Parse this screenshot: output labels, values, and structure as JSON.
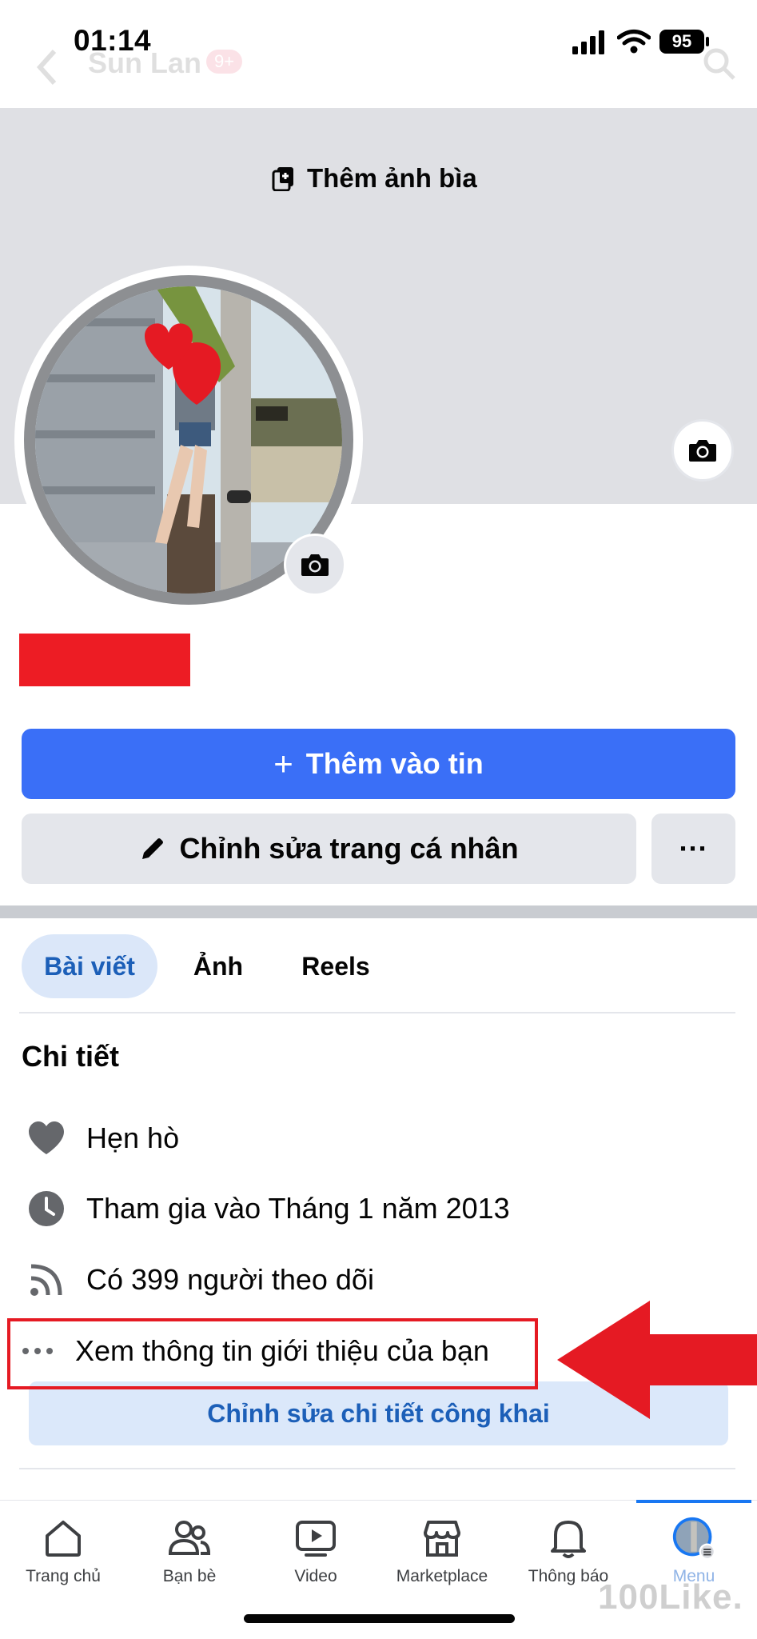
{
  "status_bar": {
    "time": "01:14",
    "battery": "95"
  },
  "header": {
    "profile_name_faded": "Sun Lan",
    "badge": "9+"
  },
  "cover": {
    "add_cover_label": "Thêm ảnh bìa"
  },
  "actions": {
    "add_story_icon": "+",
    "add_story_label": "Thêm vào tin",
    "edit_profile_label": "Chỉnh sửa trang cá nhân",
    "more_label": "···"
  },
  "tabs": [
    {
      "label": "Bài viết",
      "active": true
    },
    {
      "label": "Ảnh",
      "active": false
    },
    {
      "label": "Reels",
      "active": false
    }
  ],
  "details": {
    "title": "Chi tiết",
    "items": [
      {
        "icon": "heart-icon",
        "text": "Hẹn hò"
      },
      {
        "icon": "clock-icon",
        "text": "Tham gia vào Tháng 1 năm 2013"
      },
      {
        "icon": "rss-icon",
        "text": "Có 399 người theo dõi"
      },
      {
        "icon": "more-dots-icon",
        "text": "Xem thông tin giới thiệu của bạn"
      }
    ],
    "edit_button_label": "Chỉnh sửa chi tiết công khai"
  },
  "bottom_nav": [
    {
      "icon": "home-icon",
      "label": "Trang chủ"
    },
    {
      "icon": "friends-icon",
      "label": "Bạn bè"
    },
    {
      "icon": "video-icon",
      "label": "Video"
    },
    {
      "icon": "marketplace-icon",
      "label": "Marketplace"
    },
    {
      "icon": "bell-icon",
      "label": "Thông báo"
    },
    {
      "icon": "menu-avatar-icon",
      "label": "Menu"
    }
  ],
  "watermark": "100Like.",
  "colors": {
    "accent": "#3a6ff7",
    "annotation": "#e51a23",
    "cover": "#dfe0e4"
  }
}
